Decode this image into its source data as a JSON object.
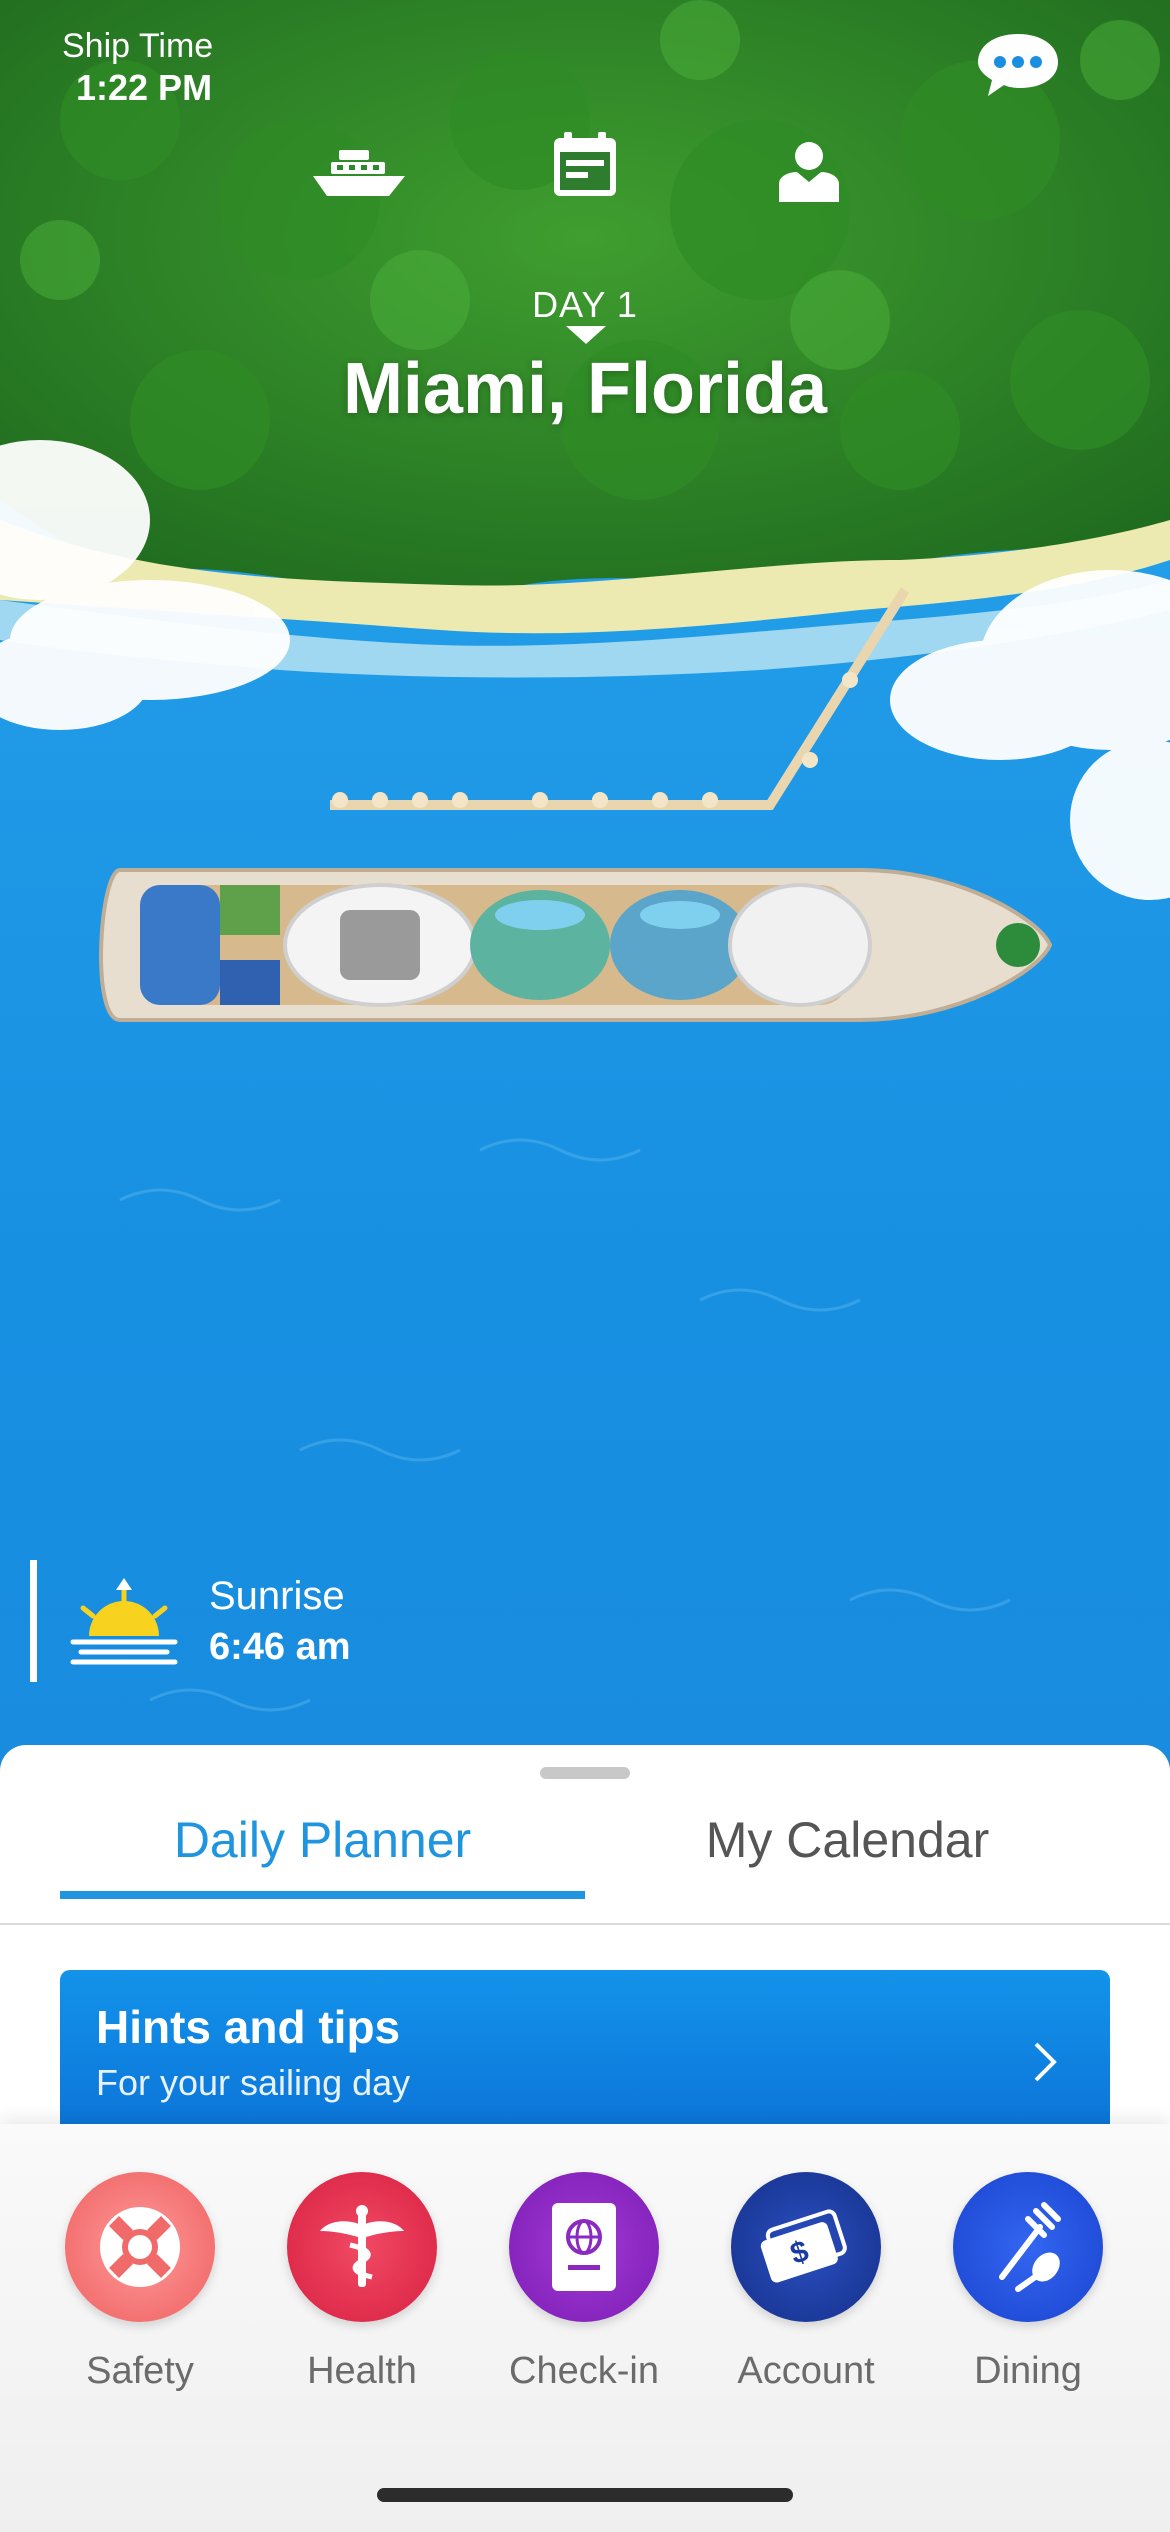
{
  "ship_time": {
    "label": "Ship Time",
    "value": "1:22 PM"
  },
  "icons": {
    "chat": "chat-bubble-icon",
    "ship": "ship-icon",
    "calendar": "calendar-icon",
    "profile": "profile-icon",
    "sunrise": "sunrise-icon"
  },
  "itinerary": {
    "day": "DAY 1",
    "port": "Miami, Florida"
  },
  "sunrise": {
    "label": "Sunrise",
    "time": "6:46 am"
  },
  "tabs": [
    {
      "label": "Daily Planner",
      "active": true
    },
    {
      "label": "My Calendar",
      "active": false
    }
  ],
  "hints": {
    "title": "Hints and tips",
    "subtitle": "For your sailing day"
  },
  "dock": [
    {
      "label": "Safety",
      "icon": "lifebuoy-icon",
      "color": "#f06a6a"
    },
    {
      "label": "Health",
      "icon": "caduceus-icon",
      "color": "#e2364e"
    },
    {
      "label": "Check-in",
      "icon": "passport-icon",
      "color": "#8a2ac0"
    },
    {
      "label": "Account",
      "icon": "cash-icon",
      "color": "#1b3aa3"
    },
    {
      "label": "Dining",
      "icon": "fork-spoon-icon",
      "color": "#1f52e0"
    }
  ],
  "colors": {
    "accent": "#1f94df",
    "ocean": "#1a8fe0",
    "jungle": "#2c8a2c"
  }
}
